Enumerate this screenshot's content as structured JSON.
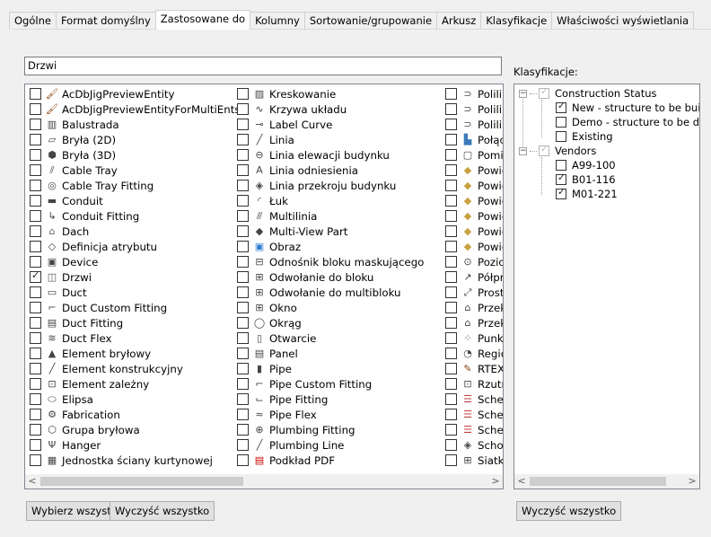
{
  "tabs": [
    "Ogólne",
    "Format domyślny",
    "Zastosowane do",
    "Kolumny",
    "Sortowanie/grupowanie",
    "Arkusz",
    "Klasyfikacje",
    "Właściwości wyświetlania"
  ],
  "active_tab": "Zastosowane do",
  "search": {
    "value": "Drzwi"
  },
  "list": {
    "columns": [
      [
        {
          "label": "AcDbJigPreviewEntity",
          "checked": false,
          "icon": "brush-icon"
        },
        {
          "label": "AcDbJigPreviewEntityForMultiEnts",
          "checked": false,
          "icon": "brush-icon"
        },
        {
          "label": "Balustrada",
          "checked": false,
          "icon": "railing-icon"
        },
        {
          "label": "Bryła (2D)",
          "checked": false,
          "icon": "mass-2d-icon"
        },
        {
          "label": "Bryła (3D)",
          "checked": false,
          "icon": "mass-3d-icon"
        },
        {
          "label": "Cable Tray",
          "checked": false,
          "icon": "cable-tray-icon"
        },
        {
          "label": "Cable Tray Fitting",
          "checked": false,
          "icon": "cable-tray-fitting-icon"
        },
        {
          "label": "Conduit",
          "checked": false,
          "icon": "conduit-icon"
        },
        {
          "label": "Conduit Fitting",
          "checked": false,
          "icon": "conduit-fitting-icon"
        },
        {
          "label": "Dach",
          "checked": false,
          "icon": "roof-icon"
        },
        {
          "label": "Definicja atrybutu",
          "checked": false,
          "icon": "attribute-definition-icon"
        },
        {
          "label": "Device",
          "checked": false,
          "icon": "device-icon"
        },
        {
          "label": "Drzwi",
          "checked": true,
          "icon": "door-icon"
        },
        {
          "label": "Duct",
          "checked": false,
          "icon": "duct-icon"
        },
        {
          "label": "Duct Custom Fitting",
          "checked": false,
          "icon": "duct-custom-fitting-icon"
        },
        {
          "label": "Duct Fitting",
          "checked": false,
          "icon": "duct-fitting-icon"
        },
        {
          "label": "Duct Flex",
          "checked": false,
          "icon": "duct-flex-icon"
        },
        {
          "label": "Element bryłowy",
          "checked": false,
          "icon": "mass-element-icon"
        },
        {
          "label": "Element konstrukcyjny",
          "checked": false,
          "icon": "structural-member-icon"
        },
        {
          "label": "Element zależny",
          "checked": false,
          "icon": "dependent-element-icon"
        },
        {
          "label": "Elipsa",
          "checked": false,
          "icon": "ellipse-icon"
        },
        {
          "label": "Fabrication",
          "checked": false,
          "icon": "fabrication-icon"
        },
        {
          "label": "Grupa bryłowa",
          "checked": false,
          "icon": "mass-group-icon"
        },
        {
          "label": "Hanger",
          "checked": false,
          "icon": "hanger-icon"
        },
        {
          "label": "Jednostka ściany kurtynowej",
          "checked": false,
          "icon": "curtain-wall-unit-icon"
        }
      ],
      [
        {
          "label": "Kreskowanie",
          "checked": false,
          "icon": "hatch-icon"
        },
        {
          "label": "Krzywa układu",
          "checked": false,
          "icon": "layout-curve-icon"
        },
        {
          "label": "Label Curve",
          "checked": false,
          "icon": "label-curve-icon"
        },
        {
          "label": "Linia",
          "checked": false,
          "icon": "line-icon"
        },
        {
          "label": "Linia elewacji budynku",
          "checked": false,
          "icon": "elevation-line-icon"
        },
        {
          "label": "Linia odniesienia",
          "checked": false,
          "icon": "leader-icon"
        },
        {
          "label": "Linia przekroju budynku",
          "checked": false,
          "icon": "section-line-icon"
        },
        {
          "label": "Łuk",
          "checked": false,
          "icon": "arc-icon"
        },
        {
          "label": "Multilinia",
          "checked": false,
          "icon": "multiline-icon"
        },
        {
          "label": "Multi-View Part",
          "checked": false,
          "icon": "multi-view-part-icon"
        },
        {
          "label": "Obraz",
          "checked": false,
          "icon": "image-icon"
        },
        {
          "label": "Odnośnik bloku maskującego",
          "checked": false,
          "icon": "mask-block-ref-icon"
        },
        {
          "label": "Odwołanie do bloku",
          "checked": false,
          "icon": "block-ref-icon"
        },
        {
          "label": "Odwołanie do multibloku",
          "checked": false,
          "icon": "multi-block-ref-icon"
        },
        {
          "label": "Okno",
          "checked": false,
          "icon": "window-icon"
        },
        {
          "label": "Okrąg",
          "checked": false,
          "icon": "circle-icon"
        },
        {
          "label": "Otwarcie",
          "checked": false,
          "icon": "opening-icon"
        },
        {
          "label": "Panel",
          "checked": false,
          "icon": "panel-icon"
        },
        {
          "label": "Pipe",
          "checked": false,
          "icon": "pipe-icon"
        },
        {
          "label": "Pipe Custom Fitting",
          "checked": false,
          "icon": "pipe-custom-fitting-icon"
        },
        {
          "label": "Pipe Fitting",
          "checked": false,
          "icon": "pipe-fitting-icon"
        },
        {
          "label": "Pipe Flex",
          "checked": false,
          "icon": "pipe-flex-icon"
        },
        {
          "label": "Plumbing Fitting",
          "checked": false,
          "icon": "plumbing-fitting-icon"
        },
        {
          "label": "Plumbing Line",
          "checked": false,
          "icon": "plumbing-line-icon"
        },
        {
          "label": "Podkład PDF",
          "checked": false,
          "icon": "pdf-underlay-icon"
        }
      ],
      [
        {
          "label": "Polilin",
          "checked": false,
          "icon": "polyline-icon"
        },
        {
          "label": "Polilin",
          "checked": false,
          "icon": "polyline-icon"
        },
        {
          "label": "Polilin",
          "checked": false,
          "icon": "polyline-icon"
        },
        {
          "label": "Połąc",
          "checked": false,
          "icon": "connection-icon"
        },
        {
          "label": "Pomi",
          "checked": false,
          "icon": "room-icon"
        },
        {
          "label": "Powie",
          "checked": false,
          "icon": "surface-icon"
        },
        {
          "label": "Powie",
          "checked": false,
          "icon": "surface-icon"
        },
        {
          "label": "Powie",
          "checked": false,
          "icon": "surface-icon"
        },
        {
          "label": "Powie",
          "checked": false,
          "icon": "surface-icon"
        },
        {
          "label": "Powie",
          "checked": false,
          "icon": "surface-icon"
        },
        {
          "label": "Powie",
          "checked": false,
          "icon": "surface-icon"
        },
        {
          "label": "Pozio",
          "checked": false,
          "icon": "level-icon"
        },
        {
          "label": "Półpr",
          "checked": false,
          "icon": "ray-icon"
        },
        {
          "label": "Prosta",
          "checked": false,
          "icon": "xline-icon"
        },
        {
          "label": "Przek",
          "checked": false,
          "icon": "section-icon"
        },
        {
          "label": "Przek",
          "checked": false,
          "icon": "section-icon"
        },
        {
          "label": "Punkt",
          "checked": false,
          "icon": "point-icon"
        },
        {
          "label": "Regio",
          "checked": false,
          "icon": "region-icon"
        },
        {
          "label": "RTEXT",
          "checked": false,
          "icon": "rtext-icon"
        },
        {
          "label": "Rzutn",
          "checked": false,
          "icon": "viewport-icon"
        },
        {
          "label": "Scher",
          "checked": false,
          "icon": "schedule-icon"
        },
        {
          "label": "Scher",
          "checked": false,
          "icon": "schedule-icon"
        },
        {
          "label": "Scher",
          "checked": false,
          "icon": "schedule-icon"
        },
        {
          "label": "Schoo",
          "checked": false,
          "icon": "stair-icon"
        },
        {
          "label": "Siatka",
          "checked": false,
          "icon": "grid-icon"
        }
      ]
    ]
  },
  "klasyfikacje_label": "Klasyfikacje:",
  "tree": [
    {
      "label": "Construction Status",
      "checked": true,
      "grey": true,
      "level": 0,
      "expander": "−"
    },
    {
      "label": "New - structure to be built",
      "checked": true,
      "grey": false,
      "level": 1
    },
    {
      "label": "Demo - structure to be demolis",
      "checked": false,
      "grey": false,
      "level": 1
    },
    {
      "label": "Existing",
      "checked": false,
      "grey": false,
      "level": 1
    },
    {
      "label": "Vendors",
      "checked": true,
      "grey": true,
      "level": 0,
      "expander": "−"
    },
    {
      "label": "A99-100",
      "checked": false,
      "grey": false,
      "level": 1
    },
    {
      "label": "B01-116",
      "checked": true,
      "grey": false,
      "level": 1
    },
    {
      "label": "M01-221",
      "checked": true,
      "grey": false,
      "level": 1
    }
  ],
  "buttons": {
    "select_all": "Wybierz wszystko",
    "clear_all_left": "Wyczyść wszystko",
    "clear_all_right": "Wyczyść wszystko"
  }
}
